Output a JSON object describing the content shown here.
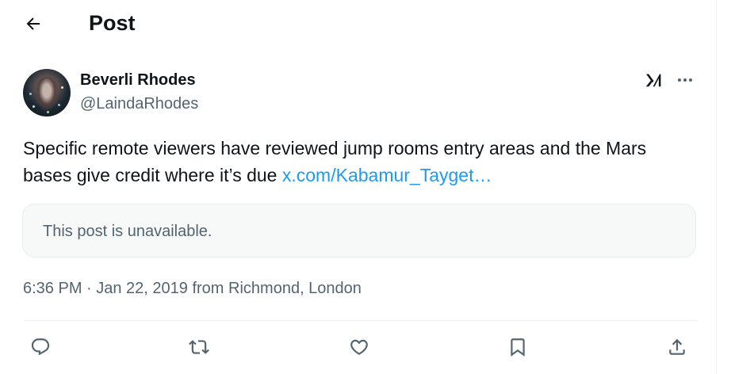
{
  "header": {
    "title": "Post"
  },
  "post": {
    "author_name": "Beverli Rhodes",
    "author_handle": "@LaindaRhodes",
    "text": "Specific remote viewers have reviewed jump rooms entry areas and  the Mars bases give credit where it’s due ",
    "link_text": "x.com/Kabamur_Tayget…",
    "quoted_unavailable": "This post is unavailable.",
    "meta": "6:36 PM · Jan 22, 2019 from Richmond, London"
  },
  "icons": {
    "back": "arrow-left-icon",
    "grok": "grok-icon",
    "more": "more-horizontal-icon",
    "reply": "reply-icon",
    "repost": "repost-icon",
    "like": "like-icon",
    "bookmark": "bookmark-icon",
    "share": "share-icon"
  },
  "colors": {
    "text": "#0f1419",
    "secondary": "#536471",
    "link": "#1d9bf0",
    "border": "#eff3f4",
    "card_bg": "#f7f9f9"
  }
}
